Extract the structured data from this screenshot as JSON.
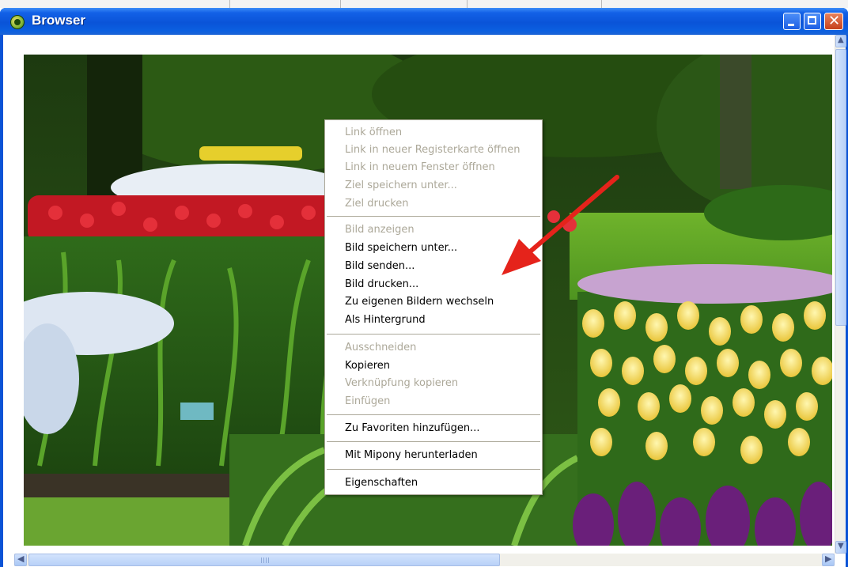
{
  "window": {
    "title": "Browser"
  },
  "colors": {
    "titlebar": "#0a54d8",
    "menu_disabled_text": "#aca899",
    "arrow": "#e5231b"
  },
  "context_menu": {
    "items": [
      {
        "label": "Link öffnen",
        "enabled": false
      },
      {
        "label": "Link in neuer Registerkarte öffnen",
        "enabled": false
      },
      {
        "label": "Link in neuem Fenster öffnen",
        "enabled": false
      },
      {
        "label": "Ziel speichern unter...",
        "enabled": false
      },
      {
        "label": "Ziel drucken",
        "enabled": false
      },
      {
        "label": "Bild anzeigen",
        "enabled": false
      },
      {
        "label": "Bild speichern unter...",
        "enabled": true
      },
      {
        "label": "Bild senden...",
        "enabled": true
      },
      {
        "label": "Bild drucken...",
        "enabled": true
      },
      {
        "label": "Zu eigenen Bildern wechseln",
        "enabled": true
      },
      {
        "label": "Als Hintergrund",
        "enabled": true
      },
      {
        "label": "Ausschneiden",
        "enabled": false
      },
      {
        "label": "Kopieren",
        "enabled": true
      },
      {
        "label": "Verknüpfung kopieren",
        "enabled": false
      },
      {
        "label": "Einfügen",
        "enabled": false
      },
      {
        "label": "Zu Favoriten hinzufügen...",
        "enabled": true
      },
      {
        "label": "Mit Mipony herunterladen",
        "enabled": true
      },
      {
        "label": "Eigenschaften",
        "enabled": true
      }
    ]
  },
  "icons": {
    "app": "app-icon",
    "minimize": "minimize-icon",
    "maximize": "maximize-icon",
    "close": "close-icon",
    "scroll_up": "scroll-up-arrow-icon",
    "scroll_down": "scroll-down-arrow-icon",
    "scroll_left": "scroll-left-arrow-icon",
    "scroll_right": "scroll-right-arrow-icon"
  },
  "glyphs": {
    "close": "✕",
    "scroll_up": "▲",
    "scroll_down": "▼",
    "scroll_left": "◀",
    "scroll_right": "▶"
  }
}
